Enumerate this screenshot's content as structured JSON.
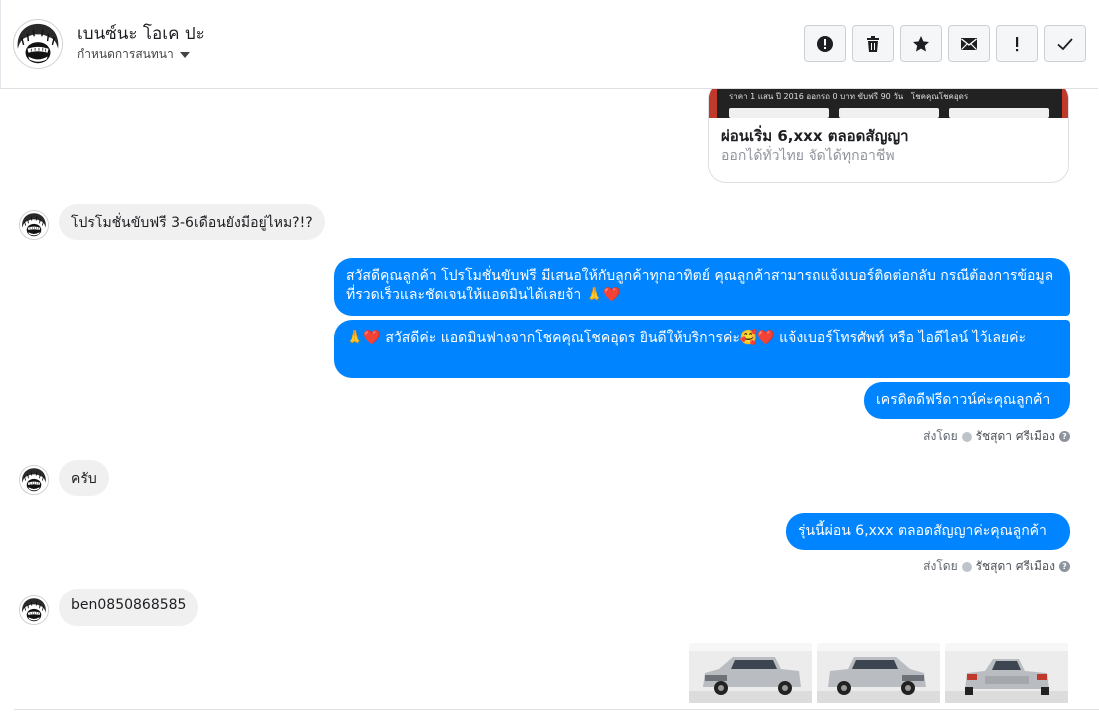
{
  "header": {
    "name": "เบนซ์นะ โอเค ปะ",
    "subtitle": "กำหนดการสนทนา",
    "actions": [
      {
        "name": "alert-button",
        "icon": "alert-circle-icon"
      },
      {
        "name": "delete-button",
        "icon": "trash-icon"
      },
      {
        "name": "star-button",
        "icon": "star-icon"
      },
      {
        "name": "unread-button",
        "icon": "envelope-icon"
      },
      {
        "name": "important-button",
        "icon": "exclamation-icon"
      },
      {
        "name": "done-button",
        "icon": "check-icon"
      }
    ]
  },
  "link_card": {
    "image_text_left": "ราคา 1 แสน ปี 2016 ออกรถ 0 บาท ขับฟรี 90 วัน",
    "image_text_right": "โชคคุณโชคอุดร",
    "title": "ผ่อนเริ่ม 6,xxx ตลอดสัญญา",
    "subtitle": "ออกได้ทั่วไทย จัดได้ทุกอาชีพ"
  },
  "messages": {
    "in1": "โปรโมชั่นขับฟรี 3-6เดือนยังมีอยู่ไหม?!?",
    "out1": "สวัสดีคุณลูกค้า โปรโมชั่นขับฟรี มีเสนอให้กับลูกค้าทุกอาทิตย์ คุณลูกค้าสามารถแจ้งเบอร์ติดต่อกลับ กรณีต้องการข้อมูลที่รวดเร็วและชัดเจนให้แอดมินได้เลยจ้า 🙏❤️",
    "out2": "🙏❤️ สวัสดีค่ะ แอดมินฟางจากโชคคุณโชคอุดร ยินดีให้บริการค่ะ🥰❤️ แจ้งเบอร์โทรศัพท์ หรือ ไอดีไลน์  ไว้เลยค่ะ",
    "out3": "เครดิตดีฟรีดาวน์ค่ะคุณลูกค้า",
    "meta1_prefix": "ส่งโดย",
    "meta1_name": "รัชสุดา ศรีเมือง",
    "in2": "ครับ",
    "out4": "รุ่นนี้ผ่อน 6,xxx ตลอดสัญญาค่ะคุณลูกค้า",
    "meta2_prefix": "ส่งโดย",
    "meta2_name": "รัชสุดา ศรีเมือง",
    "in3": "ben0850868585"
  },
  "photos": [
    "pickup-front-photo",
    "pickup-front-right-photo",
    "pickup-rear-photo"
  ],
  "colors": {
    "outgoing_bubble": "#0084ff",
    "incoming_bubble": "#f0f0f0",
    "car_silver": "#b9bcc0"
  }
}
